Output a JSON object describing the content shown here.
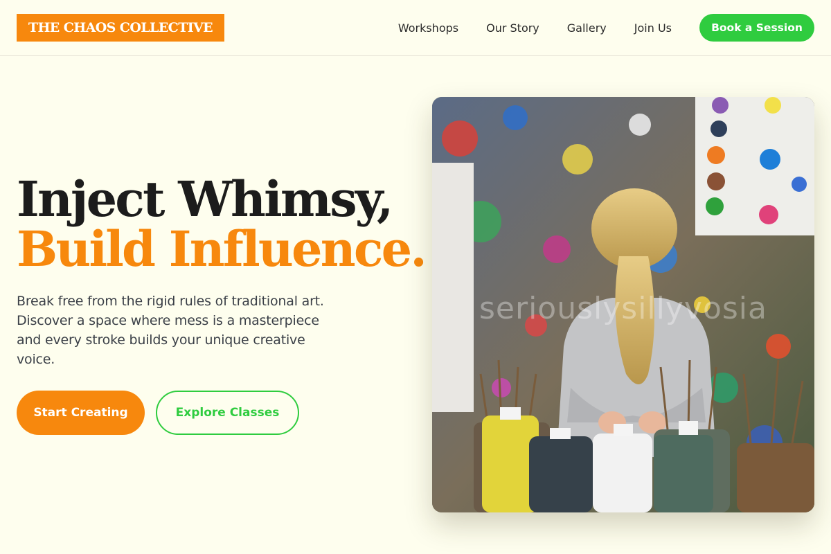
{
  "header": {
    "logo": "THE CHAOS COLLECTIVE",
    "nav": [
      "Workshops",
      "Our Story",
      "Gallery",
      "Join Us"
    ],
    "cta": "Book a Session"
  },
  "hero": {
    "title_line1": "Inject Whimsy,",
    "title_line2": "Build Influence.",
    "description": "Break free from the rigid rules of traditional art. Discover a space where mess is a masterpiece and every stroke builds your unique creative voice.",
    "primary_button": "Start Creating",
    "secondary_button": "Explore Classes",
    "image_alt": "Child in a paint-splattered art studio with brushes and paint bottles",
    "image_watermark": "seriouslysillyvosia"
  },
  "colors": {
    "background": "#fefeee",
    "accent_orange": "#f7880d",
    "accent_green": "#2fcc3f",
    "text_dark": "#1c1c1c"
  }
}
